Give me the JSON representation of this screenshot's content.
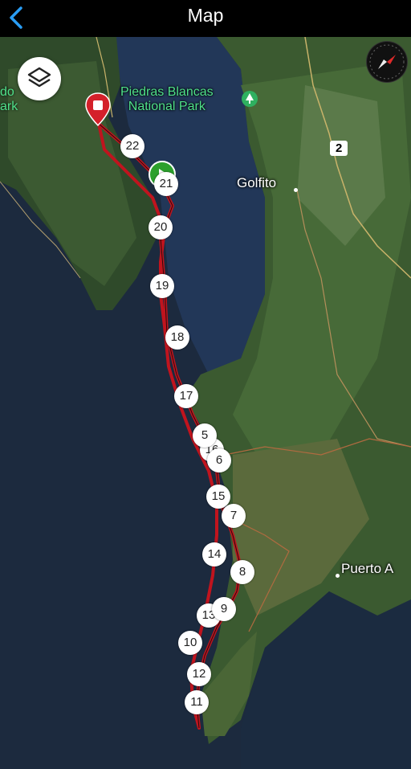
{
  "header": {
    "title": "Map",
    "back_icon": "chevron-left-icon"
  },
  "map": {
    "labels": {
      "park_name": "Piedras Blancas\nNational Park",
      "park_left_fragment": "do\nark",
      "town": "Golfito",
      "town2": "Puerto A"
    },
    "road_badge": "2",
    "controls": {
      "layers_icon": "layers-icon",
      "compass_icon": "compass-icon"
    },
    "route_color": "#c0141e",
    "waypoints": [
      "22",
      "21",
      "20",
      "19",
      "18",
      "17",
      "16",
      "15",
      "14",
      "13",
      "12",
      "11",
      "10",
      "9",
      "8",
      "7",
      "6",
      "5"
    ]
  }
}
